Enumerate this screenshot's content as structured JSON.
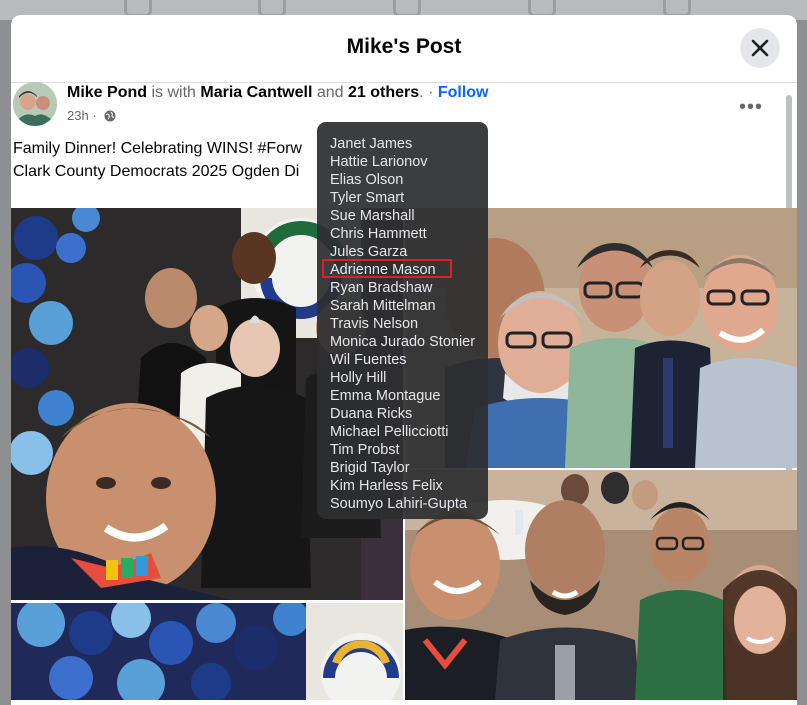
{
  "post": {
    "title": "Mike's Post",
    "author": "Mike Pond",
    "with_text": "is with",
    "tagged": "Maria Cantwell",
    "and_text": "and",
    "others": "21 others",
    "follow": "Follow",
    "time": "23h",
    "text_line1": "Family Dinner! Celebrating WINS! #Forw",
    "text_line2": "Clark County Democrats 2025 Ogden Di"
  },
  "tagged_list": [
    "Janet James",
    "Hattie Larionov",
    "Elias Olson",
    "Tyler Smart",
    "Sue Marshall",
    "Chris Hammett",
    "Jules Garza",
    "Adrienne Mason",
    "Ryan Bradshaw",
    "Sarah Mittelman",
    "Travis Nelson",
    "Monica Jurado Stonier",
    "Wil Fuentes",
    "Holly Hill",
    "Emma Montague",
    "Duana Ricks",
    "Michael Pellicciotti",
    "Tim Probst",
    "Brigid Taylor",
    "Kim Harless Felix",
    "Soumyo Lahiri-Gupta"
  ],
  "highlighted_name": "Adrienne Mason",
  "icons": {
    "close": "close-icon",
    "more": "more-options-icon",
    "privacy": "globe-icon"
  }
}
